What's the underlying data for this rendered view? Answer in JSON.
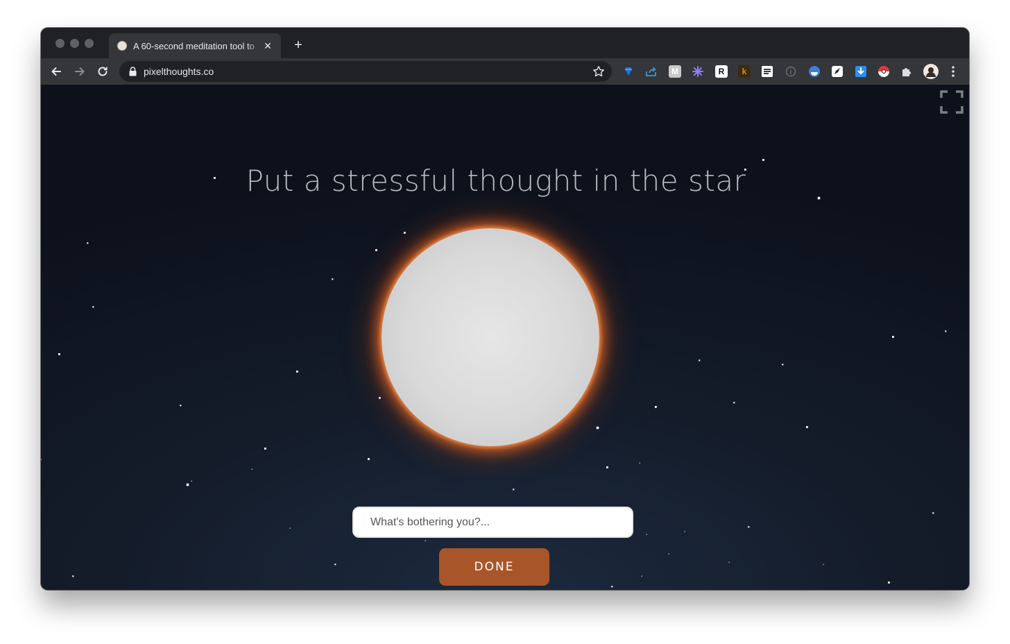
{
  "browser": {
    "tab": {
      "title": "A 60-second meditation tool to"
    },
    "address_bar": {
      "url": "pixelthoughts.co"
    },
    "extensions": [
      {
        "icon": "gem-icon",
        "color": "#1a73e8",
        "glyph": ""
      },
      {
        "icon": "share-icon",
        "color": "#2f9be8",
        "glyph": ""
      },
      {
        "icon": "m-icon",
        "color": "#c9c9c9",
        "glyph": "M"
      },
      {
        "icon": "snowflake-icon",
        "color": "#8f7cff",
        "glyph": ""
      },
      {
        "icon": "r-icon",
        "color": "#ffffff",
        "glyph": "R"
      },
      {
        "icon": "k-icon",
        "color": "#e38b1d",
        "glyph": "k"
      },
      {
        "icon": "notes-icon",
        "color": "#ffffff",
        "glyph": ""
      },
      {
        "icon": "info-icon",
        "color": "#6b6c70",
        "glyph": ""
      },
      {
        "icon": "halfmoon-icon",
        "color": "#3d7fd1",
        "glyph": ""
      },
      {
        "icon": "pen-icon",
        "color": "#ffffff",
        "glyph": ""
      },
      {
        "icon": "download-icon",
        "color": "#2f8cf0",
        "glyph": ""
      },
      {
        "icon": "pokeball-icon",
        "color": "#e53935",
        "glyph": ""
      },
      {
        "icon": "puzzle-icon",
        "color": "#dadce0",
        "glyph": ""
      },
      {
        "icon": "avatar-icon",
        "color": "#9aa0a6",
        "glyph": ""
      },
      {
        "icon": "menu-dots-icon",
        "color": "#dadce0",
        "glyph": ""
      }
    ]
  },
  "page": {
    "headline": "Put a stressful thought in the star",
    "input": {
      "placeholder": "What's bothering you?...",
      "value": ""
    },
    "done_label": "DONE",
    "glow_color": "#d6622a",
    "button_color": "#a9552a"
  }
}
